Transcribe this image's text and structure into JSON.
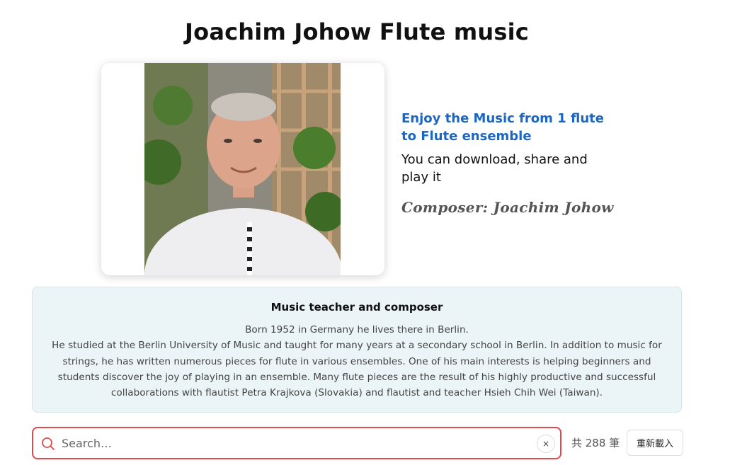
{
  "page": {
    "title": "Joachim Johow Flute music"
  },
  "intro": {
    "heading": "Enjoy the Music from 1 flute to Flute ensemble",
    "text": "You can download, share and play it",
    "composer": "Composer: Joachim Johow"
  },
  "photo": {
    "alt": "Joachim Johow"
  },
  "bio": {
    "title": "Music teacher and composer",
    "line1": "Born 1952 in Germany he lives there in Berlin.",
    "body": "He studied at the Berlin University of Music and taught for many years at a secondary school in Berlin. In addition to music for strings, he has written numerous pieces for flute in various ensembles. One of his main interests is helping beginners and students discover the joy of playing in an ensemble. Many flute pieces are the result of his highly productive and successful collaborations with flautist Petra Krajkova (Slovakia) and flautist and teacher Hsieh Chih Wei (Taiwan)."
  },
  "search": {
    "placeholder": "Search…",
    "value": "",
    "clear_label": "×",
    "icon": "search-icon"
  },
  "results": {
    "count_text": "共 288 筆"
  },
  "toolbar": {
    "reload_label": "重新載入"
  },
  "colors": {
    "accent": "#1a66c2",
    "search_border": "#e04a4a",
    "bio_background": "#ebf4f7"
  }
}
